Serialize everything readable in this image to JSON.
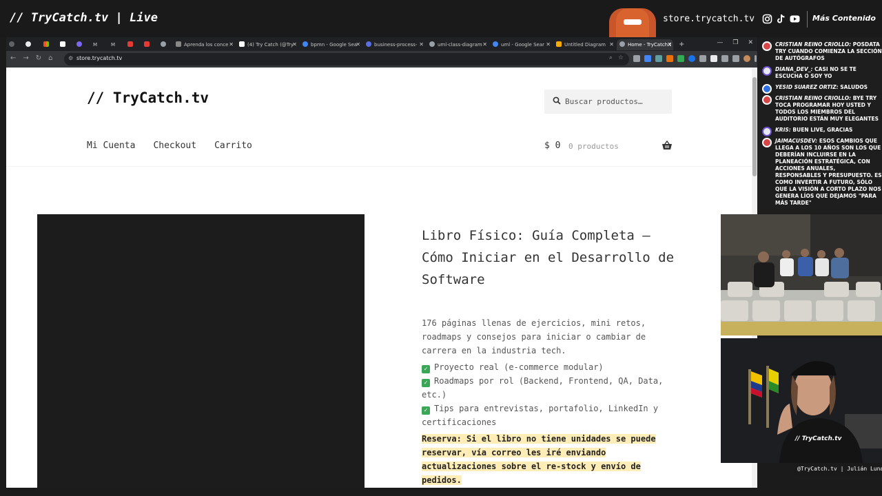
{
  "overlay": {
    "brand": "// TryCatch.tv | Live",
    "store_url": "store.trycatch.tv",
    "more_content": "Más Contenido",
    "social_icons": [
      "instagram-icon",
      "tiktok-icon",
      "youtube-icon"
    ]
  },
  "browser": {
    "tabs": [
      {
        "label": "",
        "icon": "github-icon"
      },
      {
        "label": "",
        "icon": "windows-icon"
      },
      {
        "label": "",
        "icon": "x-icon"
      },
      {
        "label": "",
        "icon": "person-icon"
      },
      {
        "label": "M",
        "icon": "medium-icon"
      },
      {
        "label": "M",
        "icon": "medium-icon"
      },
      {
        "label": "",
        "icon": "red-square-icon"
      },
      {
        "label": "",
        "icon": "red-square-icon"
      },
      {
        "label": "",
        "icon": "globe-icon"
      },
      {
        "label": "Aprenda los conce",
        "icon": "a-icon"
      },
      {
        "label": "(4) Try Catch (@Try",
        "icon": "x-icon"
      },
      {
        "label": "bpmn - Google Sea",
        "icon": "google-icon"
      },
      {
        "label": "business-process-",
        "icon": "compass-icon"
      },
      {
        "label": "uml-class-diagram",
        "icon": "globe-icon"
      },
      {
        "label": "uml - Google Sear",
        "icon": "google-icon"
      },
      {
        "label": "Untitled Diagram",
        "icon": "diagram-icon"
      },
      {
        "label": "Home - TryCatch.t",
        "icon": "globe-icon"
      }
    ],
    "url": "store.trycatch.tv"
  },
  "site": {
    "title": "// TryCatch.tv",
    "search_placeholder": "Buscar productos…",
    "nav": [
      "Mi Cuenta",
      "Checkout",
      "Carrito"
    ],
    "cart_total": "$ 0",
    "cart_count": "0 productos"
  },
  "product": {
    "title": "Libro Físico: Guía Completa – Cómo Iniciar en el Desarrollo de Software",
    "description": "176 páginas llenas de ejercicios, mini retos, roadmaps y consejos para iniciar o cambiar de carrera en la industria tech.",
    "bullets": [
      "Proyecto real (e-commerce modular)",
      "Roadmaps por rol (Backend, Frontend, QA, Data, etc.)",
      "Tips para entrevistas, portafolio, LinkedIn y certificaciones"
    ],
    "reserve_note": "Reserva: Si el libro no tiene unidades se puede reservar, vía correo les iré enviando actualizaciones sobre el re-stock y envío de pedidos."
  },
  "chat": [
    {
      "name": "Cristian Reino Criollo:",
      "text": " Posdata Try cuando comienza la sección de autógrafos"
    },
    {
      "name": "diana_dev_:",
      "text": " Casi no se te escucha o soy yo"
    },
    {
      "name": "Yesid Suarez Ortiz:",
      "text": " Saludos"
    },
    {
      "name": "Cristian Reino Criollo:",
      "text": " Bye Try toca programar hoy usted y todos los miembros del auditorio están muy elegantes"
    },
    {
      "name": "kris:",
      "text": " buen live, gracias"
    },
    {
      "name": "jaimacusdev:",
      "text": " Esos cambios que llega a los 10 años son los que deberían incluirse en la planeación estratégica, con acciones anuales, responsables y presupuesto. Es como invertir a futuro, sólo que la visión a corto plazo nos genera líos que dejamos \"para más tarde\""
    }
  ],
  "camera_tag": "@TryCatch.tv | Julián Luna"
}
